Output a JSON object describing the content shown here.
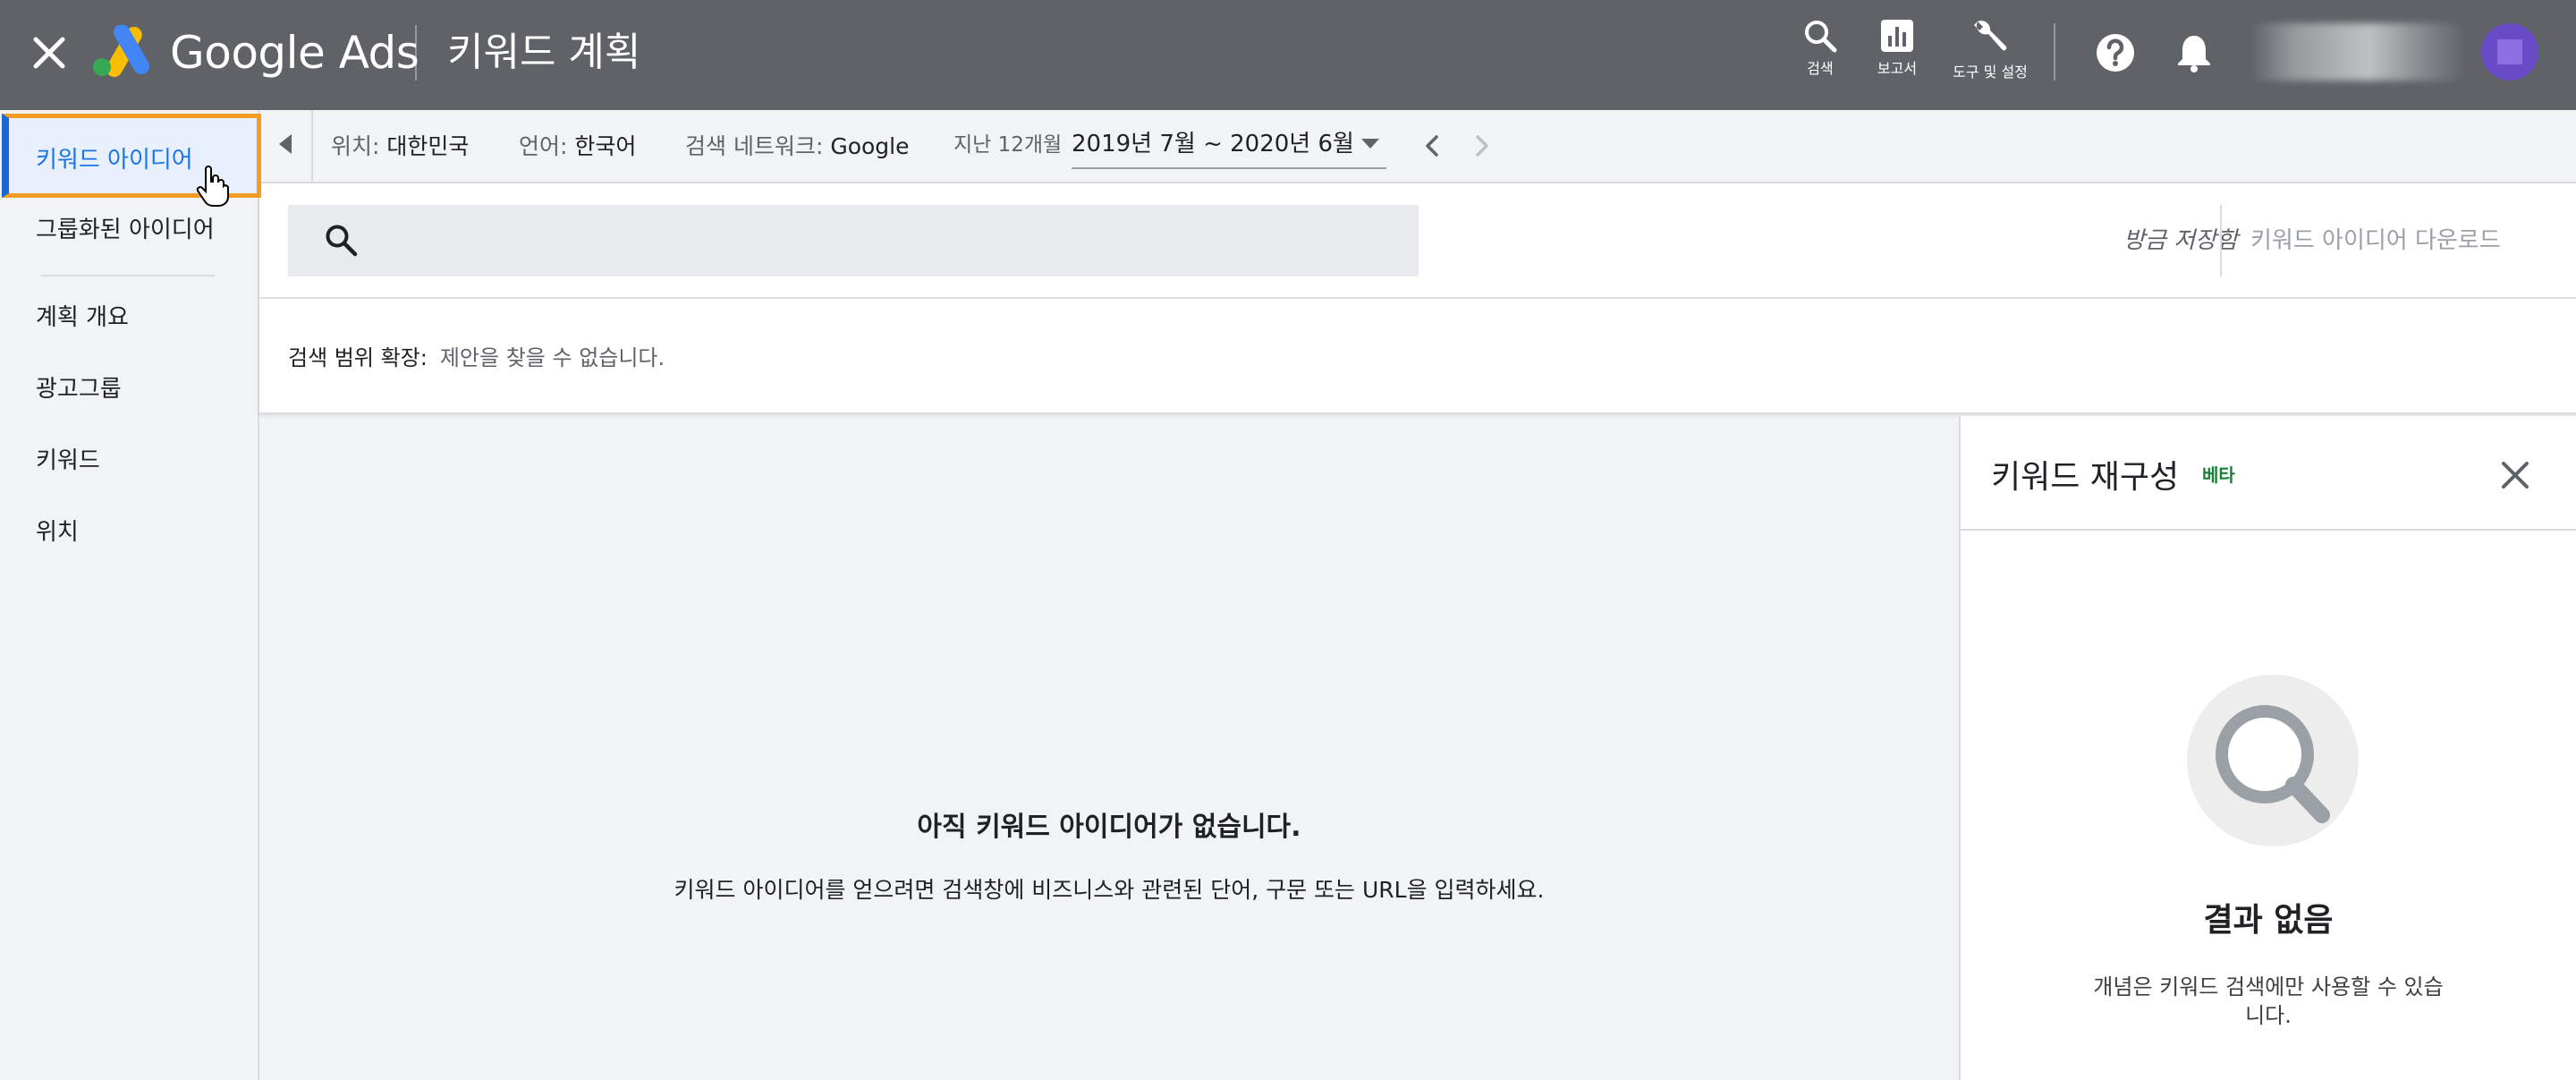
{
  "header": {
    "brand": "Google Ads",
    "page_title": "키워드 계획",
    "tools": [
      {
        "icon": "search-icon",
        "label": "검색"
      },
      {
        "icon": "bar-chart-icon",
        "label": "보고서"
      },
      {
        "icon": "wrench-icon",
        "label": "도구 및 설정"
      }
    ]
  },
  "sidebar": {
    "items": [
      {
        "label": "키워드 아이디어",
        "active": true
      },
      {
        "label": "그룹화된 아이디어"
      },
      {
        "label": "계획 개요"
      },
      {
        "label": "광고그룹"
      },
      {
        "label": "키워드"
      },
      {
        "label": "위치"
      }
    ]
  },
  "filters": {
    "location_label": "위치:",
    "location_value": "대한민국",
    "language_label": "언어:",
    "language_value": "한국어",
    "network_label": "검색 네트워크:",
    "network_value": "Google",
    "date_label": "지난 12개월",
    "date_value": "2019년 7월 ~ 2020년 6월"
  },
  "search": {
    "placeholder": "",
    "saved_status": "방금 저장함",
    "download_label": "키워드 아이디어 다운로드",
    "broaden_label": "검색 범위 확장:",
    "broaden_value": "제안을 찾을 수 없습니다."
  },
  "empty_state": {
    "title": "아직 키워드 아이디어가 없습니다.",
    "description": "키워드 아이디어를 얻으려면 검색창에 비즈니스와 관련된 단어, 구문 또는 URL을 입력하세요."
  },
  "refine_panel": {
    "title": "키워드 재구성",
    "badge": "베타",
    "no_result_title": "결과 없음",
    "no_result_desc": "개념은 키워드 검색에만 사용할 수 있습니다."
  },
  "colors": {
    "header_bg": "#5f6368",
    "accent": "#1a73e8",
    "highlight": "#f59d22",
    "beta": "#188038"
  }
}
